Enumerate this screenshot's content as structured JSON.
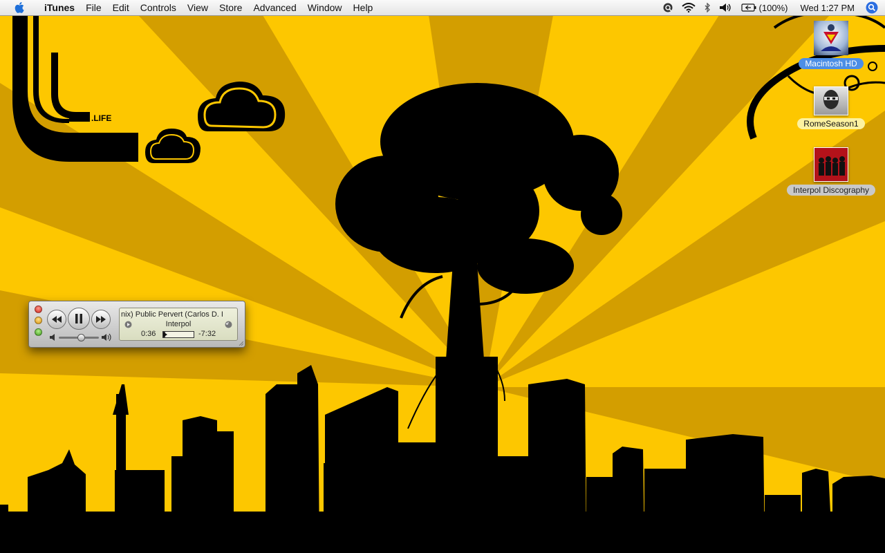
{
  "menubar": {
    "apple_icon": "apple-icon",
    "app_name": "iTunes",
    "menus": [
      "File",
      "Edit",
      "Controls",
      "View",
      "Store",
      "Advanced",
      "Window",
      "Help"
    ],
    "status": {
      "battery_label": "(100%)",
      "clock": "Wed 1:27 PM",
      "icons": [
        "quicksilver-icon",
        "wifi-icon",
        "bluetooth-icon",
        "volume-icon",
        "battery-icon",
        "spotlight-icon"
      ]
    }
  },
  "wallpaper": {
    "brand_text": ".LIFE",
    "colors": {
      "ray_light": "#fdc700",
      "ray_dark": "#d39e00",
      "silhouette": "#000000"
    }
  },
  "desktop_icons": [
    {
      "label": "Macintosh HD",
      "icon": "hard-drive-icon",
      "selected": true
    },
    {
      "label": "RomeSeason1",
      "icon": "disk-image-icon",
      "selected": false
    },
    {
      "label": "Interpol Discography",
      "icon": "folder-album-icon",
      "selected": false
    }
  ],
  "mini_player": {
    "track_title": "nix)   Public Pervert (Carlos D. I",
    "artist": "Interpol",
    "elapsed": "0:36",
    "remaining": "-7:32",
    "progress_fraction": 0.07,
    "volume_fraction": 0.55,
    "controls": [
      "previous-icon",
      "pause-icon",
      "next-icon"
    ]
  }
}
